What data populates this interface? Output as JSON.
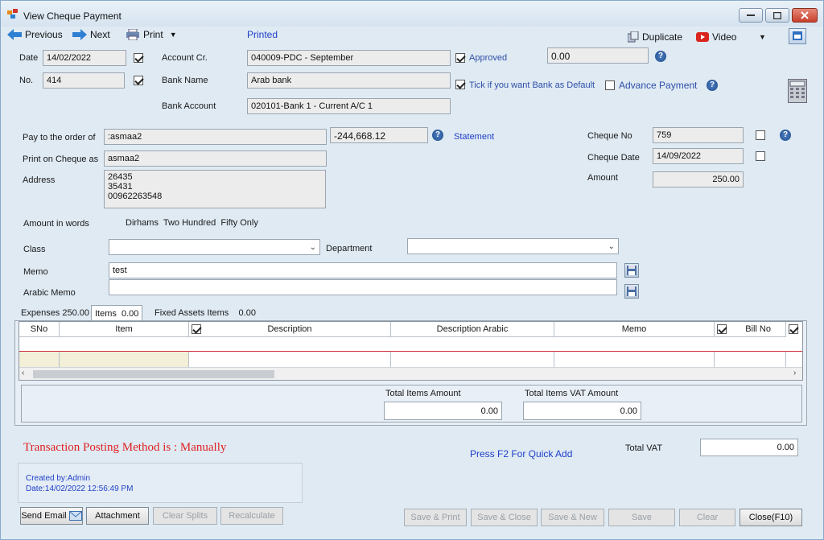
{
  "window": {
    "title": "View Cheque Payment"
  },
  "toolbar": {
    "previous": "Previous",
    "next": "Next",
    "print": "Print",
    "status": "Printed",
    "duplicate": "Duplicate",
    "video": "Video"
  },
  "header": {
    "date_label": "Date",
    "date_value": "14/02/2022",
    "no_label": "No.",
    "no_value": "414",
    "account_cr_label": "Account Cr.",
    "account_cr_value": "040009-PDC - September",
    "bank_name_label": "Bank Name",
    "bank_name_value": "Arab bank",
    "bank_account_label": "Bank Account",
    "bank_account_value": "020101-Bank 1 - Current A/C 1",
    "approved_label": "Approved",
    "approved_amount": "0.00",
    "default_bank_label": "Tick if you want Bank as Default",
    "advance_payment_label": "Advance Payment"
  },
  "payee": {
    "pay_to_label": "Pay to the order of",
    "pay_to_value": ":asmaa2",
    "balance": "-244,668.12",
    "statement_link": "Statement",
    "print_on_cheque_label": "Print on Cheque as",
    "print_on_cheque_value": "asmaa2",
    "address_label": "Address",
    "address_lines": [
      "26435",
      "35431",
      "00962263548"
    ],
    "cheque_no_label": "Cheque No",
    "cheque_no_value": "759",
    "cheque_date_label": "Cheque Date",
    "cheque_date_value": "14/09/2022",
    "amount_label": "Amount",
    "amount_value": "250.00",
    "amount_in_words_label": "Amount in words",
    "amount_in_words_value": "Dirhams  Two Hundred  Fifty Only"
  },
  "classification": {
    "class_label": "Class",
    "class_value": "",
    "department_label": "Department",
    "department_value": "",
    "memo_label": "Memo",
    "memo_value": "test",
    "arabic_memo_label": "Arabic Memo",
    "arabic_memo_value": ""
  },
  "tabs": [
    {
      "label": "Expenses 250.00"
    },
    {
      "label": "Items  0.00"
    },
    {
      "label": "Fixed Assets Items    0.00"
    }
  ],
  "grid": {
    "columns": [
      "SNo",
      "Item",
      "Description",
      "Description Arabic",
      "Memo",
      "Bill No"
    ]
  },
  "totals": {
    "items_amount_label": "Total Items Amount",
    "items_amount_value": "0.00",
    "items_vat_label": "Total Items VAT Amount",
    "items_vat_value": "0.00",
    "total_vat_label": "Total VAT",
    "total_vat_value": "0.00"
  },
  "footer": {
    "posting_method": "Transaction Posting Method is : Manually",
    "quick_add_hint": "Press F2 For Quick Add",
    "created_by": "Created by:Admin",
    "created_date": "Date:14/02/2022 12:56:49 PM",
    "buttons": {
      "send_email": "Send Email",
      "attachment": "Attachment",
      "clear_splits": "Clear Splits",
      "recalculate": "Recalculate",
      "save_print": "Save & Print",
      "save_close": "Save & Close",
      "save_new": "Save & New",
      "save": "Save",
      "clear": "Clear",
      "close": "Close(F10)"
    }
  },
  "colors": {
    "background": "#dfeaf3",
    "link_blue": "#1f3fc8",
    "posting_red": "#e02020"
  }
}
